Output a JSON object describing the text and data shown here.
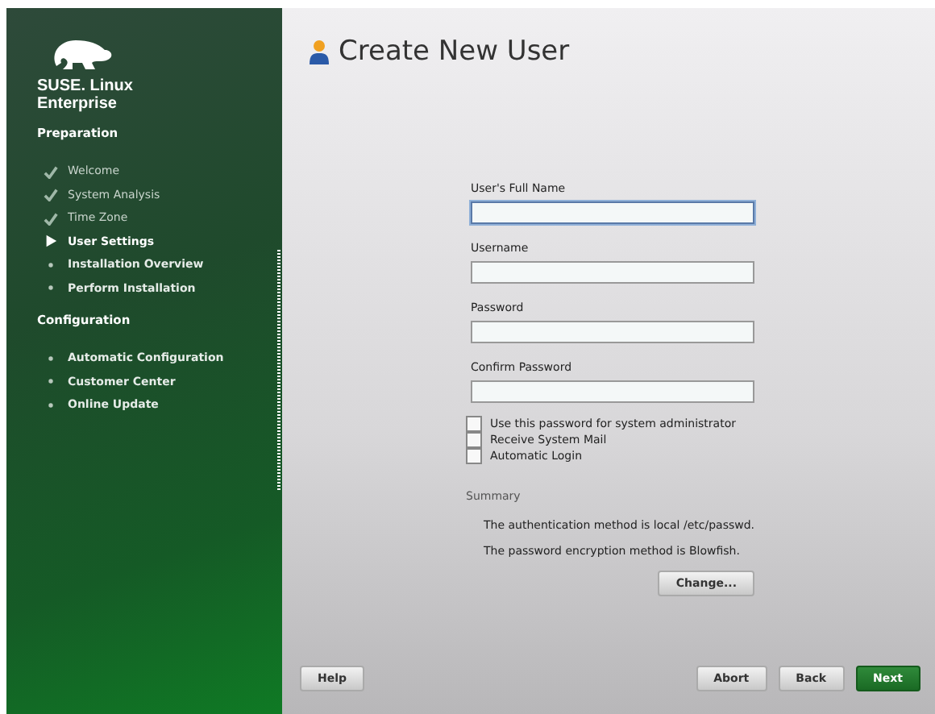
{
  "sidebar": {
    "logo_text": [
      "SUSE. Linux",
      "Enterprise"
    ],
    "sections": [
      {
        "title": "Preparation",
        "steps": [
          {
            "label": "Welcome",
            "kind": "done"
          },
          {
            "label": "System Analysis",
            "kind": "done"
          },
          {
            "label": "Time Zone",
            "kind": "done"
          },
          {
            "label": "User Settings",
            "kind": "current"
          },
          {
            "label": "Installation Overview",
            "kind": "pending"
          },
          {
            "label": "Perform Installation",
            "kind": "pending"
          }
        ]
      },
      {
        "title": "Configuration",
        "steps": [
          {
            "label": "Automatic Configuration",
            "kind": "pending"
          },
          {
            "label": "Customer Center",
            "kind": "pending"
          },
          {
            "label": "Online Update",
            "kind": "pending"
          }
        ]
      }
    ]
  },
  "title": "Create New User",
  "fields": [
    {
      "label": "User's Full Name",
      "focused": true
    },
    {
      "label": "Username",
      "focused": false
    },
    {
      "label": "Password",
      "focused": false
    },
    {
      "label": "Confirm Password",
      "focused": false
    }
  ],
  "checkboxes": [
    {
      "label": "Use this password for system administrator",
      "checked": false
    },
    {
      "label": "Receive System Mail",
      "checked": false
    },
    {
      "label": "Automatic Login",
      "checked": false
    }
  ],
  "summary": {
    "title": "Summary",
    "lines": [
      "The authentication method is local /etc/passwd.",
      "The password encryption method is Blowfish."
    ],
    "button": "Change..."
  },
  "buttons": {
    "help": "Help",
    "abort": "Abort",
    "back": "Back",
    "next": "Next"
  }
}
